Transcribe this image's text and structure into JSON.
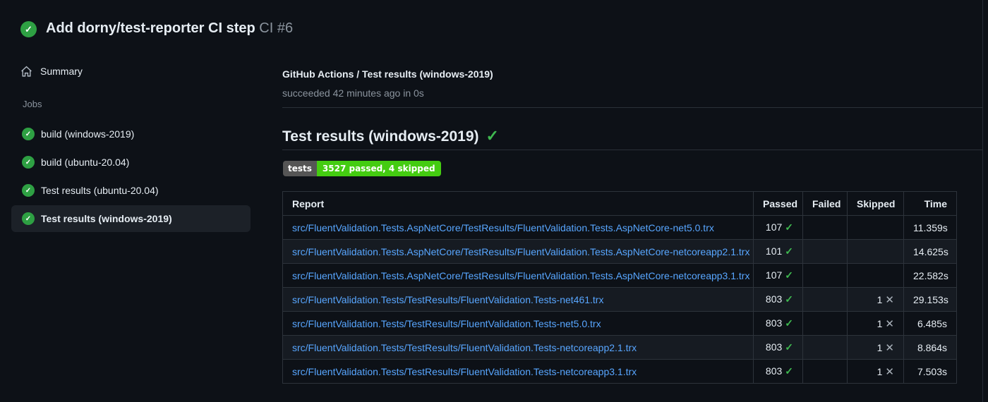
{
  "header": {
    "title": "Add dorny/test-reporter CI step",
    "run_number": "CI #6",
    "status_icon": "check-circle",
    "status_color": "#2ea043"
  },
  "sidebar": {
    "summary_label": "Summary",
    "jobs_label": "Jobs",
    "jobs": [
      {
        "label": "build (windows-2019)",
        "status": "success",
        "selected": false
      },
      {
        "label": "build (ubuntu-20.04)",
        "status": "success",
        "selected": false
      },
      {
        "label": "Test results (ubuntu-20.04)",
        "status": "success",
        "selected": false
      },
      {
        "label": "Test results (windows-2019)",
        "status": "success",
        "selected": true
      }
    ]
  },
  "main": {
    "breadcrumb": "GitHub Actions / Test results (windows-2019)",
    "status_line": "succeeded 42 minutes ago in 0s",
    "heading": "Test results (windows-2019)",
    "heading_check": "✓",
    "badge": {
      "label": "tests",
      "value": "3527 passed, 4 skipped",
      "label_bg": "#555555",
      "value_bg": "#44cc11"
    },
    "table": {
      "columns": [
        "Report",
        "Passed",
        "Failed",
        "Skipped",
        "Time"
      ],
      "check_glyph": "✓",
      "cross_glyph": "✕",
      "rows": [
        {
          "report": "src/FluentValidation.Tests.AspNetCore/TestResults/FluentValidation.Tests.AspNetCore-net5.0.trx",
          "passed": "107",
          "failed": "",
          "skipped": "",
          "time": "11.359s"
        },
        {
          "report": "src/FluentValidation.Tests.AspNetCore/TestResults/FluentValidation.Tests.AspNetCore-netcoreapp2.1.trx",
          "passed": "101",
          "failed": "",
          "skipped": "",
          "time": "14.625s"
        },
        {
          "report": "src/FluentValidation.Tests.AspNetCore/TestResults/FluentValidation.Tests.AspNetCore-netcoreapp3.1.trx",
          "passed": "107",
          "failed": "",
          "skipped": "",
          "time": "22.582s"
        },
        {
          "report": "src/FluentValidation.Tests/TestResults/FluentValidation.Tests-net461.trx",
          "passed": "803",
          "failed": "",
          "skipped": "1",
          "time": "29.153s"
        },
        {
          "report": "src/FluentValidation.Tests/TestResults/FluentValidation.Tests-net5.0.trx",
          "passed": "803",
          "failed": "",
          "skipped": "1",
          "time": "6.485s"
        },
        {
          "report": "src/FluentValidation.Tests/TestResults/FluentValidation.Tests-netcoreapp2.1.trx",
          "passed": "803",
          "failed": "",
          "skipped": "1",
          "time": "8.864s"
        },
        {
          "report": "src/FluentValidation.Tests/TestResults/FluentValidation.Tests-netcoreapp3.1.trx",
          "passed": "803",
          "failed": "",
          "skipped": "1",
          "time": "7.503s"
        }
      ]
    }
  },
  "colors": {
    "background": "#0d1117",
    "alt_row": "#161b22",
    "selected_item": "#1c2128",
    "link": "#58a6ff",
    "success_green": "#3fb950",
    "muted_text": "#8b949e",
    "table_border": "#2d333b"
  }
}
